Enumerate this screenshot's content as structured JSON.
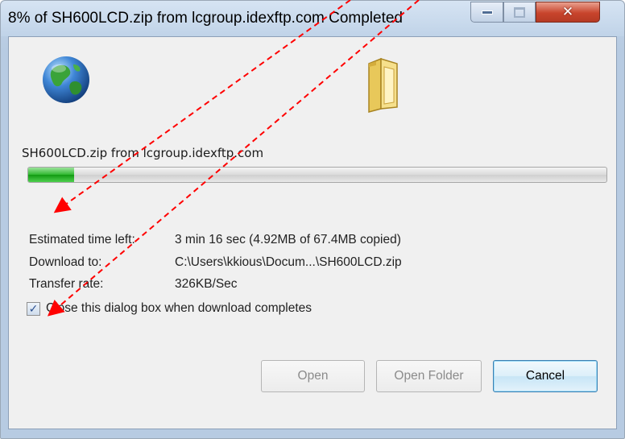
{
  "window": {
    "title": "8% of SH600LCD.zip from lcgroup.idexftp.com Completed"
  },
  "icons": {
    "source": "globe-icon",
    "destination": "folder-icon",
    "minimize": "minimize-icon",
    "maximize": "maximize-icon",
    "close": "close-icon",
    "close_glyph": "✕"
  },
  "download": {
    "file_label": "SH600LCD.zip from lcgroup.idexftp.com",
    "progress_percent": 8
  },
  "info": {
    "estimated_label": "Estimated time left:",
    "estimated_value": "3 min 16 sec (4.92MB of 67.4MB copied)",
    "download_to_label": "Download to:",
    "download_to_value": "C:\\Users\\kkious\\Docum...\\SH600LCD.zip",
    "transfer_rate_label": "Transfer rate:",
    "transfer_rate_value": "326KB/Sec"
  },
  "options": {
    "close_when_done_label": "Close this dialog box when download completes",
    "close_when_done_checked": true,
    "check_glyph": "✓"
  },
  "buttons": {
    "open": "Open",
    "open_folder": "Open Folder",
    "cancel": "Cancel"
  },
  "colors": {
    "progress_fill": "#1faa1f",
    "annotation_arrow": "#ff0000",
    "close_button": "#c8442c"
  }
}
